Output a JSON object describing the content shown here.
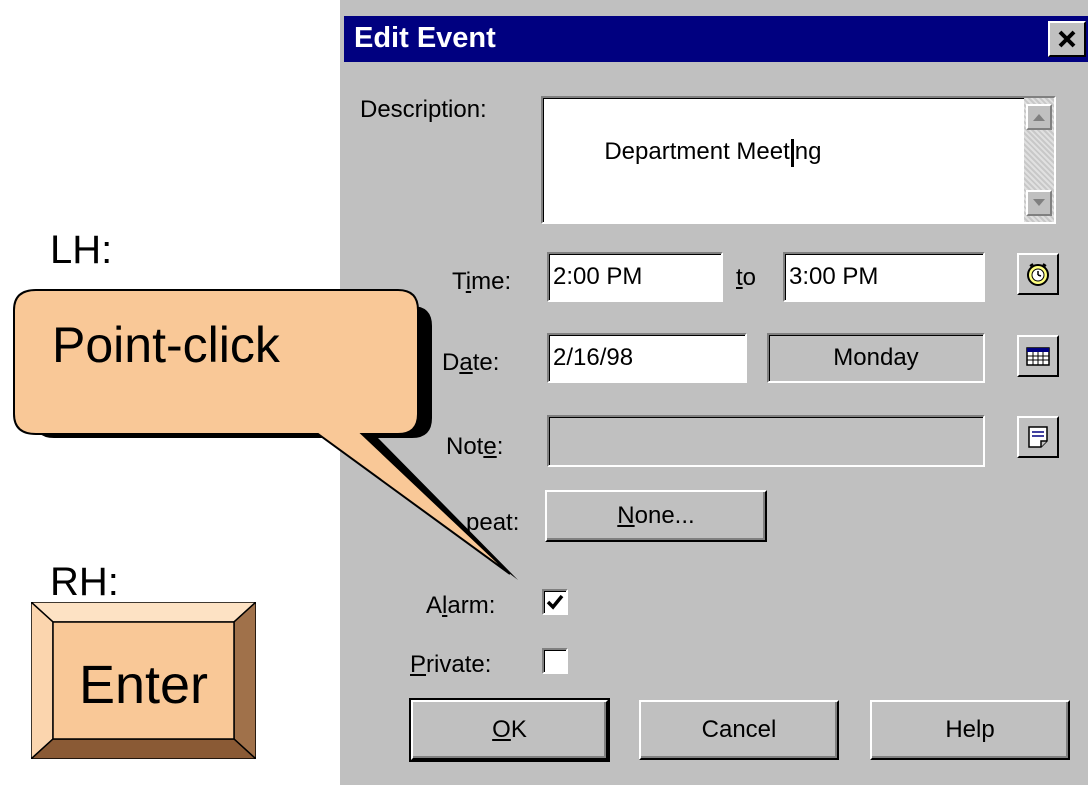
{
  "dialog": {
    "title": "Edit Event",
    "description_label": "Description:",
    "description_value_before_caret": "Department Meet",
    "description_value_after_caret": "ng",
    "time_label": "Time:",
    "time_start": "2:00 PM",
    "to_label": "to",
    "time_end": "3:00 PM",
    "date_label": "Date:",
    "date_value": "2/16/98",
    "weekday": "Monday",
    "note_label": "Note:",
    "repeat_label": "peat:",
    "repeat_value": "None...",
    "alarm_label": "Alarm:",
    "alarm_checked": true,
    "private_label": "Private:",
    "private_checked": false,
    "ok_label": "OK",
    "cancel_label": "Cancel",
    "help_label": "Help"
  },
  "annotations": {
    "lh_label": "LH:",
    "rh_label": "RH:",
    "callout_text": "Point-click",
    "enter_key_text": "Enter"
  },
  "colors": {
    "title_bar": "#000080",
    "dialog_face": "#c0c0c0",
    "callout_fill": "#f9c897",
    "key_fill": "#f9c897"
  }
}
